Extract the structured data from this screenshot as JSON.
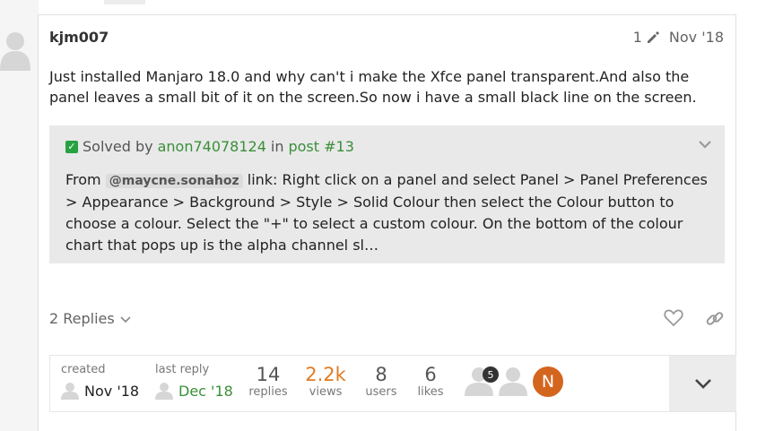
{
  "post": {
    "username": "kjm007",
    "edit_count": "1",
    "date": "Nov '18",
    "body": "Just installed Manjaro 18.0 and why can't i make the Xfce panel transparent.And also the panel leaves a small bit of it on the screen.So now i have a small black line on the screen."
  },
  "solved": {
    "prefix": "Solved by",
    "user": "anon74078124",
    "in_text": "in",
    "post_link": "post #13",
    "text_before": "From",
    "mention": "@maycne.sonahoz",
    "text_after": "link: Right click on a panel and select Panel > Panel Preferences > Appearance > Background > Style > Solid Colour then select the Colour button to choose a colour. Select the \"+\" to select a custom colour. On the bottom of the colour chart that pops up is the alpha channel sl…"
  },
  "actions": {
    "replies_label": "2 Replies"
  },
  "topic_map": {
    "created_label": "created",
    "created_date": "Nov '18",
    "last_reply_label": "last reply",
    "last_reply_date": "Dec '18",
    "stats": [
      {
        "num": "14",
        "label": "replies"
      },
      {
        "num": "2.2k",
        "label": "views"
      },
      {
        "num": "8",
        "label": "users"
      },
      {
        "num": "6",
        "label": "likes"
      }
    ],
    "participant_badge": "5",
    "participant_initial": "N"
  },
  "colors": {
    "accent_green": "#3a8f3a",
    "views_orange": "#e07b22",
    "avatar_orange": "#d4651f"
  }
}
